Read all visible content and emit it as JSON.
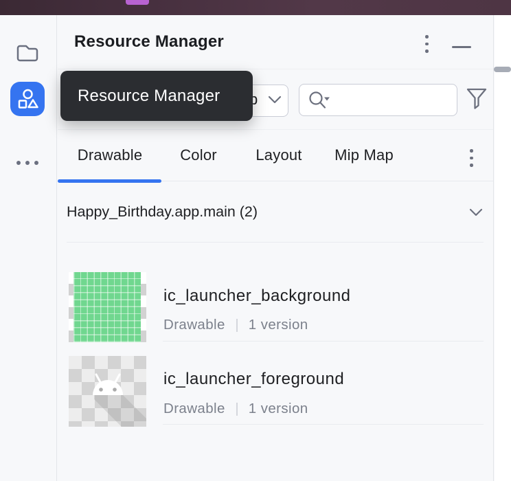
{
  "window": {
    "titlebar_accent_color": "#b863d1",
    "titlebar_bg": "#47303f"
  },
  "panel": {
    "title": "Resource Manager",
    "tooltip": {
      "text": "Resource Manager"
    },
    "toolbar": {
      "module_dropdown": {
        "visible_text": "p"
      },
      "search": {
        "value": "",
        "placeholder": ""
      }
    },
    "tabs": [
      {
        "label": "Drawable",
        "active": true
      },
      {
        "label": "Color",
        "active": false
      },
      {
        "label": "Layout",
        "active": false
      },
      {
        "label": "Mip Map",
        "active": false
      }
    ],
    "section": {
      "title": "Happy_Birthday.app.main (2)"
    },
    "items": [
      {
        "name": "ic_launcher_background",
        "type": "Drawable",
        "versions": "1 version",
        "thumbnail": "green-grid"
      },
      {
        "name": "ic_launcher_foreground",
        "type": "Drawable",
        "versions": "1 version",
        "thumbnail": "android-robot-checkerboard"
      }
    ]
  },
  "icons": {
    "sidebar": [
      "folder-icon",
      "resource-manager-icon",
      "more-dots-icon"
    ],
    "header": [
      "kebab-menu-icon",
      "minimize-icon"
    ],
    "toolbar": [
      "chevron-down-icon",
      "search-icon",
      "filter-funnel-icon"
    ],
    "tabs": [
      "kebab-menu-icon"
    ],
    "section": [
      "chevron-down-icon"
    ]
  },
  "colors": {
    "accent_blue": "#3574F0",
    "tooltip_bg": "#2b2d31",
    "thumbnail_green": "#70d78f",
    "icon_gray": "#6c707e"
  }
}
